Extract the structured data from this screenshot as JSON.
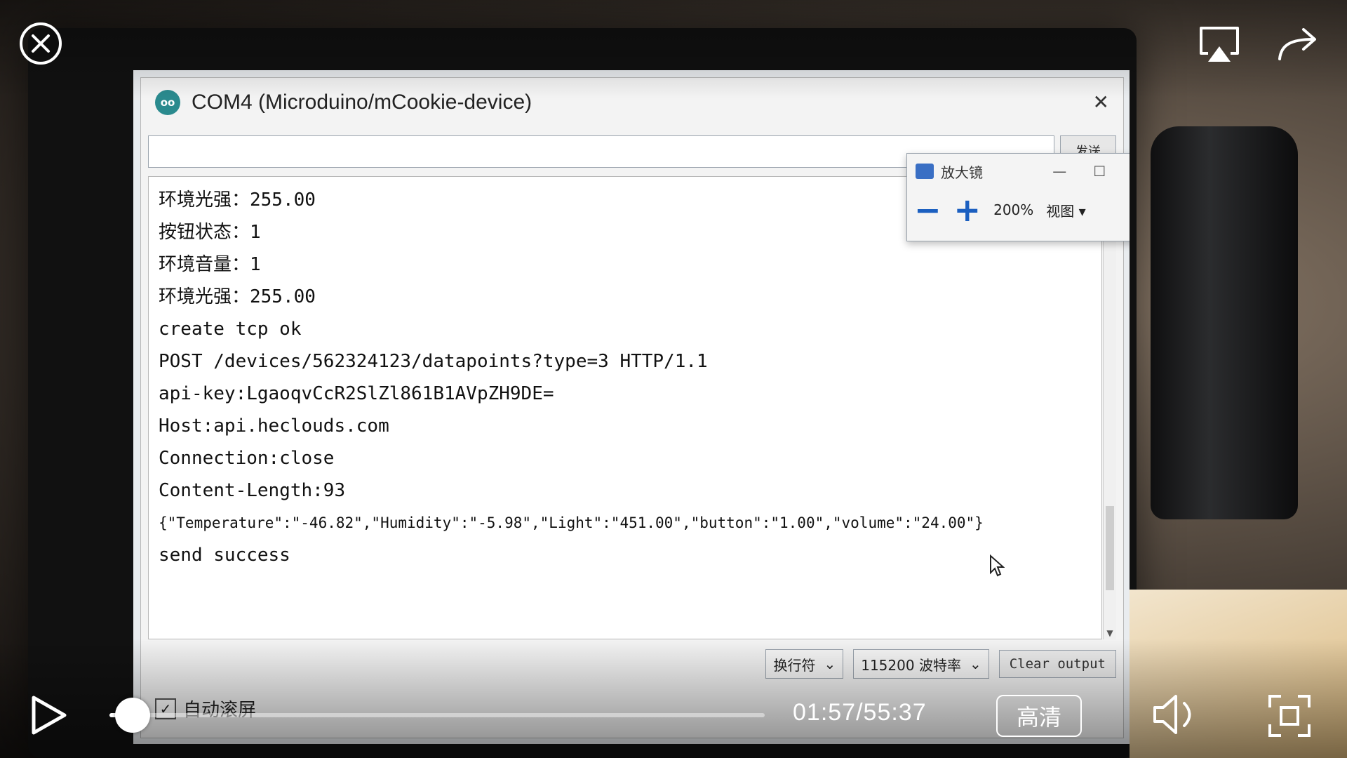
{
  "window": {
    "title": "COM4 (Microduino/mCookie-device)",
    "logo_text": "oo",
    "send_input_value": "",
    "send_label": "发送",
    "close_glyph": "✕"
  },
  "output": {
    "lines": [
      "环境光强：255.00",
      "按钮状态：1",
      "环境音量：1",
      "环境光强：255.00",
      "create tcp ok",
      "POST /devices/562324123/datapoints?type=3 HTTP/1.1",
      "api-key:LgaoqvCcR2SlZl861B1AVpZH9DE=",
      "Host:api.heclouds.com",
      "Connection:close",
      "Content-Length:93",
      "{\"Temperature\":\"-46.82\",\"Humidity\":\"-5.98\",\"Light\":\"451.00\",\"button\":\"1.00\",\"volume\":\"24.00\"}",
      "",
      "send success"
    ]
  },
  "bottom": {
    "line_ending": "换行符",
    "baud_rate": "115200 波特率",
    "clear_label": "Clear output",
    "autoscroll_label": "自动滚屏",
    "autoscroll_checked": true
  },
  "magnifier": {
    "title": "放大镜",
    "minimize": "—",
    "maximize": "☐",
    "close": "✕",
    "minus": "−",
    "plus": "+",
    "zoom": "200%",
    "view_label": "视图 ▾"
  },
  "player": {
    "time": "01:57/55:37",
    "progress": 0.035,
    "quality_label": "高清"
  },
  "colors": {
    "accent": "#1b5fc0",
    "logo": "#2a8a8e"
  }
}
